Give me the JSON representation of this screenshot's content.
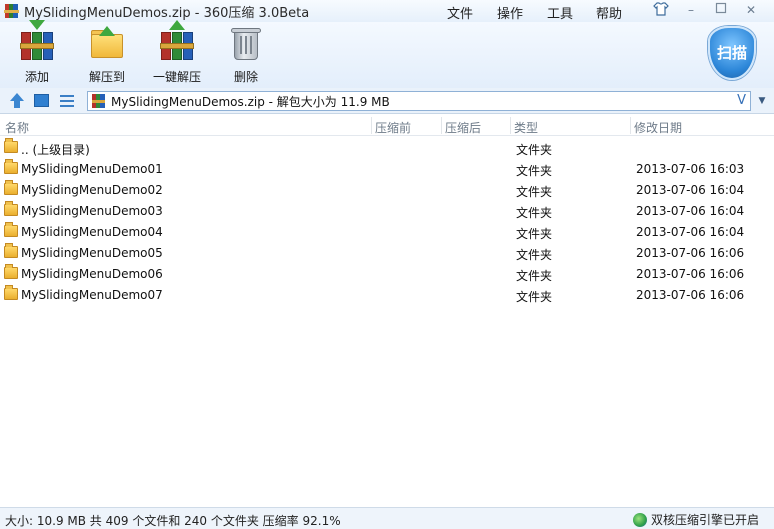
{
  "window": {
    "title": "MySlidingMenuDemos.zip - 360压缩 3.0Beta",
    "menu": [
      "文件",
      "操作",
      "工具",
      "帮助"
    ]
  },
  "toolbar": {
    "buttons": [
      {
        "label": "添加",
        "icon": "add-archive-icon"
      },
      {
        "label": "解压到",
        "icon": "extract-to-icon"
      },
      {
        "label": "一键解压",
        "icon": "one-click-extract-icon"
      },
      {
        "label": "删除",
        "icon": "delete-icon"
      }
    ],
    "scan_label": "扫描"
  },
  "address": {
    "path": "MySlidingMenuDemos.zip - 解包大小为 11.9 MB",
    "v_glyph": "V"
  },
  "columns": [
    "名称",
    "压缩前",
    "压缩后",
    "类型",
    "修改日期"
  ],
  "files": [
    {
      "name": ".. (上级目录)",
      "type": "文件夹",
      "modified": ""
    },
    {
      "name": "MySlidingMenuDemo01",
      "type": "文件夹",
      "modified": "2013-07-06 16:03"
    },
    {
      "name": "MySlidingMenuDemo02",
      "type": "文件夹",
      "modified": "2013-07-06 16:04"
    },
    {
      "name": "MySlidingMenuDemo03",
      "type": "文件夹",
      "modified": "2013-07-06 16:04"
    },
    {
      "name": "MySlidingMenuDemo04",
      "type": "文件夹",
      "modified": "2013-07-06 16:04"
    },
    {
      "name": "MySlidingMenuDemo05",
      "type": "文件夹",
      "modified": "2013-07-06 16:06"
    },
    {
      "name": "MySlidingMenuDemo06",
      "type": "文件夹",
      "modified": "2013-07-06 16:06"
    },
    {
      "name": "MySlidingMenuDemo07",
      "type": "文件夹",
      "modified": "2013-07-06 16:06"
    }
  ],
  "status": {
    "summary": "大小: 10.9 MB 共 409 个文件和 240 个文件夹 压缩率 92.1%",
    "engine": "双核压缩引擎已开启"
  }
}
